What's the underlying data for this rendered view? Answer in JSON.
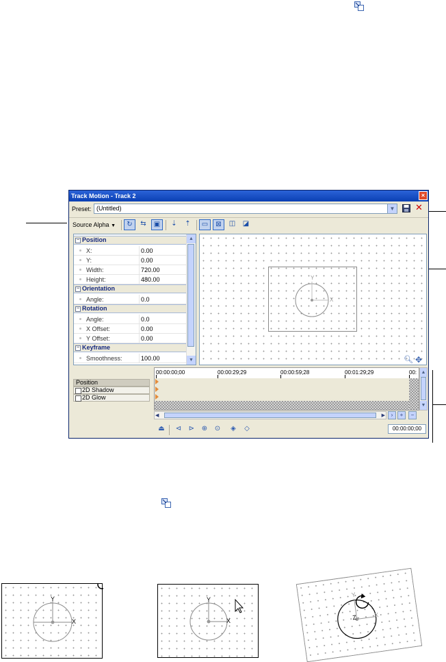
{
  "window": {
    "title": "Track Motion - Track 2",
    "close": "×",
    "preset_label": "Preset:",
    "preset_value": "(Untitled)",
    "delete": "✕",
    "source_alpha": "Source Alpha",
    "source_alpha_arrow": "▼"
  },
  "properties": {
    "sections": [
      {
        "title": "Position",
        "rows": [
          {
            "name": "X:",
            "value": "0.00"
          },
          {
            "name": "Y:",
            "value": "0.00"
          },
          {
            "name": "Width:",
            "value": "720.00"
          },
          {
            "name": "Height:",
            "value": "480.00"
          }
        ]
      },
      {
        "title": "Orientation",
        "rows": [
          {
            "name": "Angle:",
            "value": "0.0"
          }
        ]
      },
      {
        "title": "Rotation",
        "rows": [
          {
            "name": "Angle:",
            "value": "0.0"
          },
          {
            "name": "X Offset:",
            "value": "0.00"
          },
          {
            "name": "Y Offset:",
            "value": "0.00"
          }
        ]
      },
      {
        "title": "Keyframe",
        "rows": [
          {
            "name": "Smoothness:",
            "value": "100.00"
          }
        ]
      }
    ]
  },
  "preview": {
    "axis_x": "X",
    "axis_y": "Y"
  },
  "timeline": {
    "ruler": [
      "00:00:00;00",
      "00:00:29;29",
      "00:00:59;28",
      "00:01:29;29",
      "00:"
    ],
    "tracks": [
      {
        "label": "Position",
        "checkbox": false
      },
      {
        "label": "2D Shadow",
        "checkbox": true
      },
      {
        "label": "2D Glow",
        "checkbox": true
      }
    ],
    "time": "00:00:00;00"
  },
  "bottom_panels": {
    "p1": {
      "y": "Y",
      "x": "X"
    },
    "p2": {
      "y": "Y",
      "x": "X"
    },
    "p3": {
      "y": "Y",
      "x": "X",
      "z": "Z"
    }
  }
}
